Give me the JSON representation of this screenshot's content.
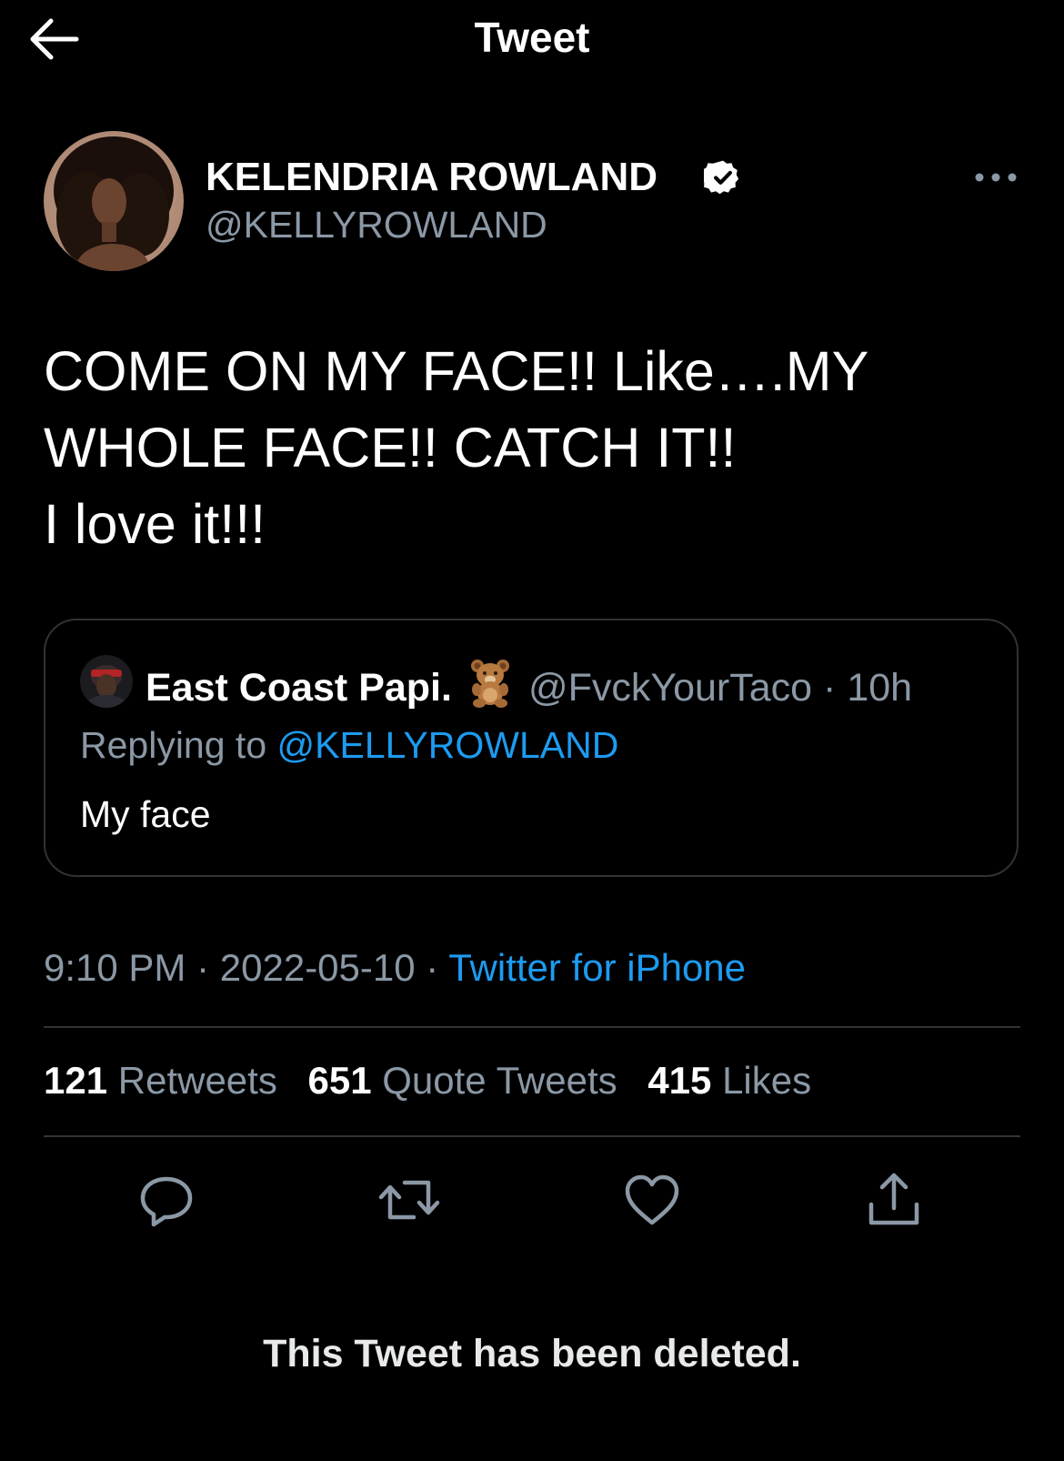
{
  "header": {
    "title": "Tweet",
    "back_icon": "arrow-left-icon"
  },
  "tweet": {
    "author_name": "KELENDRIA ROWLAND",
    "author_handle": "@KELLYROWLAND",
    "verified_icon": "verified-badge-icon",
    "more_icon": "more-horizontal-icon",
    "text_lines": [
      "COME ON MY FACE!! Like….MY",
      "WHOLE FACE!! CATCH IT!!",
      "I love it!!!"
    ],
    "time": "9:10 PM",
    "date": "2022-05-10",
    "separator": "·",
    "source": "Twitter for iPhone"
  },
  "quote": {
    "name": "East Coast Papi.",
    "emoji_icon": "teddy-bear-icon",
    "handle": "@FvckYourTaco",
    "separator": "·",
    "time": "10h",
    "replying_prefix": "Replying to",
    "replying_mention": "@KELLYROWLAND",
    "text": "My face"
  },
  "stats": {
    "retweets_count": "121",
    "retweets_label": "Retweets",
    "quotes_count": "651",
    "quotes_label": "Quote Tweets",
    "likes_count": "415",
    "likes_label": "Likes"
  },
  "actions": [
    "reply-icon",
    "retweet-icon",
    "like-icon",
    "share-icon"
  ],
  "deleted_notice": "This Tweet has been deleted.",
  "colors": {
    "background": "#000000",
    "text": "#ffffff",
    "secondary": "#8b98a5",
    "link": "#1d9bf0",
    "divider": "#2f3336"
  }
}
